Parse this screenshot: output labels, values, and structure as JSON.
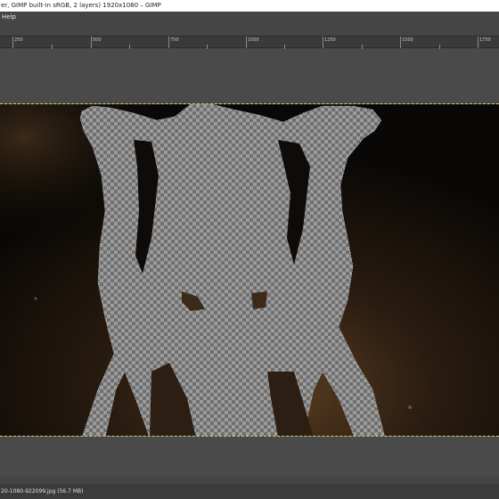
{
  "window": {
    "title": "er, GIMP built-in sRGB, 2 layers) 1920x1080 – GIMP"
  },
  "menu": {
    "items": [
      "Help"
    ]
  },
  "ruler": {
    "labels": [
      "250",
      "500",
      "750",
      "1000",
      "1250",
      "1500",
      "1750"
    ]
  },
  "status": {
    "file_info": "20-1080-922099.jpg (56.7 MB)"
  },
  "colors": {
    "selection_marching_ants": "#d8d36a",
    "canvas_background": "#0d0a07",
    "checker_light": "#9b9b9b",
    "checker_dark": "#6f6f6f"
  }
}
